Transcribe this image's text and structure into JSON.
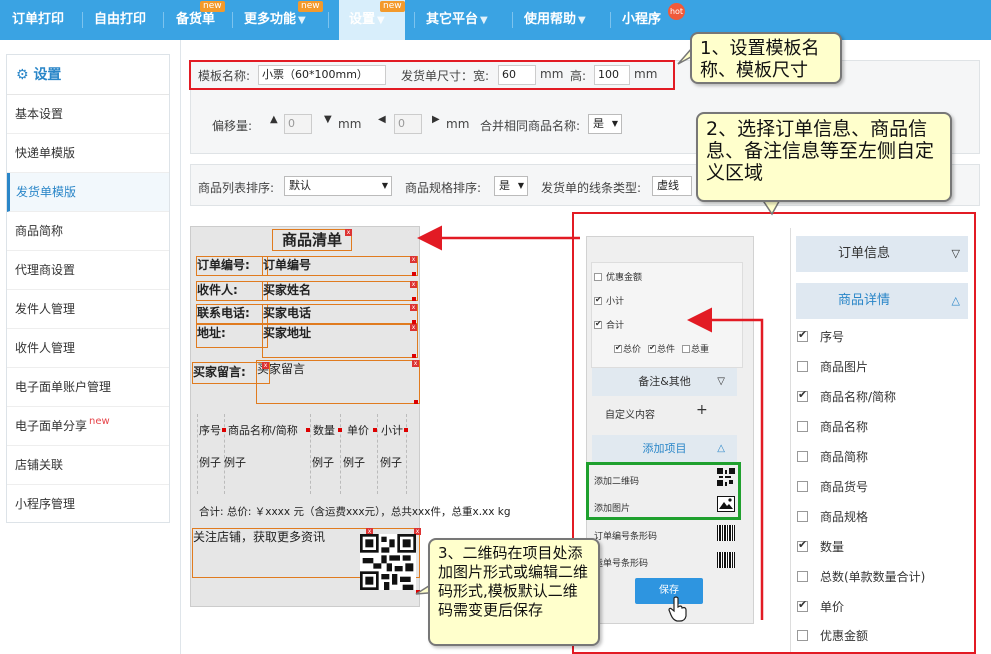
{
  "nav": {
    "items": [
      {
        "label": "订单打印",
        "badge": ""
      },
      {
        "label": "自由打印",
        "badge": ""
      },
      {
        "label": "备货单",
        "badge": "new"
      },
      {
        "label": "更多功能",
        "badge": "new"
      },
      {
        "label": "设置",
        "badge": "new"
      },
      {
        "label": "其它平台",
        "badge": ""
      },
      {
        "label": "使用帮助",
        "badge": ""
      },
      {
        "label": "小程序",
        "badge": "hot"
      }
    ],
    "active": "设置",
    "arrow": "▼",
    "new_badge": "new",
    "hot_badge": "hot"
  },
  "sidebar": {
    "title": "设置",
    "items": [
      {
        "label": "基本设置"
      },
      {
        "label": "快递单模版"
      },
      {
        "label": "发货单模版"
      },
      {
        "label": "商品简称"
      },
      {
        "label": "代理商设置"
      },
      {
        "label": "发件人管理"
      },
      {
        "label": "收件人管理"
      },
      {
        "label": "电子面单账户管理"
      },
      {
        "label": "电子面单分享"
      },
      {
        "label": "店铺关联"
      },
      {
        "label": "小程序管理"
      }
    ],
    "active": "发货单模版",
    "new_label": "new"
  },
  "settings": {
    "template_name_label": "模板名称:",
    "template_name_value": "小票（60*100mm）",
    "size_label": "发货单尺寸：宽:",
    "width_value": "60",
    "unit": "mm",
    "height_label": "高:",
    "height_value": "100",
    "offset_label": "偏移量:",
    "offset_up": "0",
    "offset_left": "0",
    "merge_label": "合并相同商品名称:",
    "merge_value": "是",
    "sort_label": "商品列表排序:",
    "sort_value": "默认",
    "spec_sort_label": "商品规格排序:",
    "spec_sort_value": "是",
    "line_type_label": "发货单的线条类型:",
    "line_type_value": "虚线"
  },
  "receipt": {
    "title": "商品清单",
    "order_no_label": "订单编号:",
    "order_no_value": "订单编号",
    "receiver_label": "收件人:",
    "receiver_value": "买家姓名",
    "phone_label": "联系电话:",
    "phone_value": "买家电话",
    "address_label": "地址:",
    "address_value": "买家地址",
    "message_label": "买家留言:",
    "message_value": "买家留言",
    "table_headers": [
      "序号",
      "商品名称/简称",
      "数量",
      "单价",
      "小计"
    ],
    "table_row": [
      "例子",
      "例子",
      "例子",
      "例子",
      "例子"
    ],
    "summary": "合计: 总价: ￥xxxx 元（含运费xxx元），总共xxx件，总重x.xx kg",
    "follow_text": "关注店铺，获取更多资讯"
  },
  "middle": {
    "items": [
      {
        "label": "优惠金额",
        "checked": false
      },
      {
        "label": "小计",
        "checked": true
      },
      {
        "label": "合计",
        "checked": true
      }
    ],
    "sub_items": [
      {
        "label": "总价",
        "checked": true
      },
      {
        "label": "总件",
        "checked": true
      },
      {
        "label": "总重",
        "checked": false
      }
    ],
    "notes_header": "备注&其他",
    "custom_content": "自定义内容",
    "plus": "+",
    "add_header": "添加项目",
    "add_qr": "添加二维码",
    "add_image": "添加图片",
    "order_barcode": "订单编号条形码",
    "tracking_barcode": "运单号条形码",
    "save": "保存",
    "down_arrow": "▽",
    "up_arrow": "△"
  },
  "right_panel": {
    "order_info": "订单信息",
    "product_detail": "商品详情",
    "down_arrow": "▽",
    "up_arrow": "△",
    "items": [
      {
        "label": "序号",
        "checked": true
      },
      {
        "label": "商品图片",
        "checked": false
      },
      {
        "label": "商品名称/简称",
        "checked": true
      },
      {
        "label": "商品名称",
        "checked": false
      },
      {
        "label": "商品简称",
        "checked": false
      },
      {
        "label": "商品货号",
        "checked": false
      },
      {
        "label": "商品规格",
        "checked": false
      },
      {
        "label": "数量",
        "checked": true
      },
      {
        "label": "总数(单款数量合计)",
        "checked": false
      },
      {
        "label": "单价",
        "checked": true
      },
      {
        "label": "优惠金额",
        "checked": false
      }
    ]
  },
  "callouts": {
    "c1": "1、设置模板名称、模板尺寸",
    "c2": "2、选择订单信息、商品信息、备注信息等至左侧自定义区域",
    "c3": "3、二维码在项目处添加图片形式或编辑二维码形式,模板默认二维码需变更后保存"
  },
  "colors": {
    "nav_bg": "#3aa3e3",
    "accent": "#2a86c8",
    "annotation_red": "#e21b24",
    "annotation_green": "#1fa02e",
    "callout_bg": "#ffffcc",
    "save_button": "#2e95e0"
  }
}
